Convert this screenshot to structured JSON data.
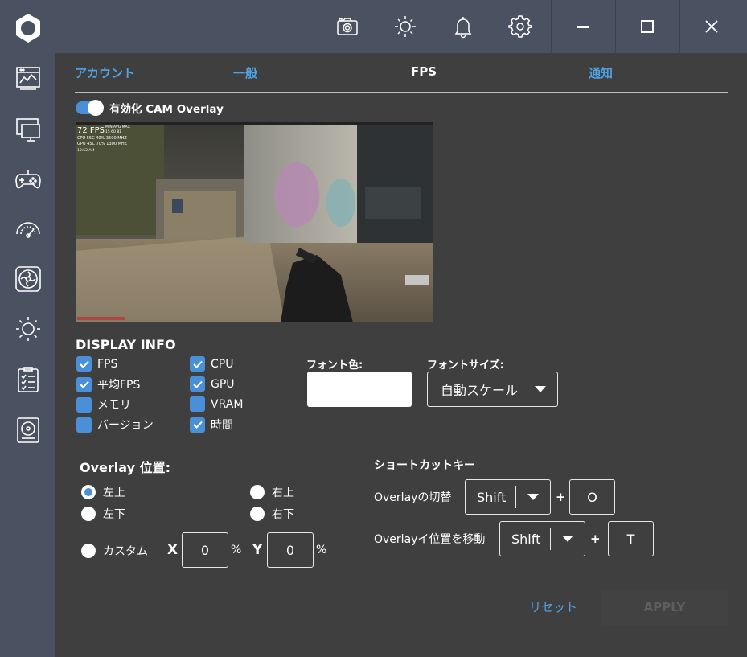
{
  "sidebar": {
    "items": [
      {
        "icon": "dashboard-icon"
      },
      {
        "icon": "monitor-icon"
      },
      {
        "icon": "gamepad-icon"
      },
      {
        "icon": "speedometer-icon"
      },
      {
        "icon": "fan-icon"
      },
      {
        "icon": "brightness-icon"
      },
      {
        "icon": "clipboard-icon"
      },
      {
        "icon": "disk-icon"
      }
    ]
  },
  "topbar": {
    "icons": [
      "camera-icon",
      "brightness-icon",
      "bell-icon",
      "gear-icon"
    ],
    "window_buttons": [
      "minimize-icon",
      "maximize-icon",
      "close-icon"
    ]
  },
  "tabs": [
    {
      "label": "アカウント"
    },
    {
      "label": "一般"
    },
    {
      "label": "FPS"
    },
    {
      "label": "通知"
    }
  ],
  "active_tab": "FPS",
  "overlay_toggle": {
    "label": "有効化 CAM Overlay",
    "enabled": true
  },
  "preview": {
    "fps_text": "72 FPS",
    "stats_header": "MIN AVG MAX",
    "stats_values": "15 60 81",
    "cpu_row": "CPU 55C 40% 3500 MHZ",
    "gpu_row": "GPU 45C 70% 1300 MHZ",
    "clock": "10:52 AM"
  },
  "display_info": {
    "title": "DISPLAY INFO",
    "col1": [
      {
        "label": "FPS",
        "checked": true
      },
      {
        "label": "平均FPS",
        "checked": true
      },
      {
        "label": "メモリ",
        "checked": false
      },
      {
        "label": "バージョン",
        "checked": false
      }
    ],
    "col2": [
      {
        "label": "CPU",
        "checked": true
      },
      {
        "label": "GPU",
        "checked": true
      },
      {
        "label": "VRAM",
        "checked": false
      },
      {
        "label": "時間",
        "checked": true
      }
    ],
    "font_color_label": "フォント色:",
    "font_color_value": "#ffffff",
    "font_size_label": "フォントサイズ:",
    "font_size_value": "自動スケール"
  },
  "position": {
    "title": "Overlay 位置:",
    "options": [
      {
        "label": "左上",
        "checked": true
      },
      {
        "label": "右上",
        "checked": false
      },
      {
        "label": "左下",
        "checked": false
      },
      {
        "label": "右下",
        "checked": false
      },
      {
        "label": "カスタム",
        "checked": false
      }
    ],
    "x_label": "X",
    "x_value": "0",
    "y_label": "Y",
    "y_value": "0",
    "unit": "%"
  },
  "shortcuts": {
    "title": "ショートカットキー",
    "rows": [
      {
        "label": "Overlayの切替",
        "modifier": "Shift",
        "key": "O"
      },
      {
        "label": "Overlayイ位置を移動",
        "modifier": "Shift",
        "key": "T"
      }
    ],
    "plus": "+"
  },
  "actions": {
    "reset": "リセット",
    "apply": "APPLY"
  },
  "colors": {
    "sidebar": "#4a5261",
    "content": "#3f3f3f",
    "accent": "#4a90d9",
    "tab_link": "#4fa3e3"
  }
}
